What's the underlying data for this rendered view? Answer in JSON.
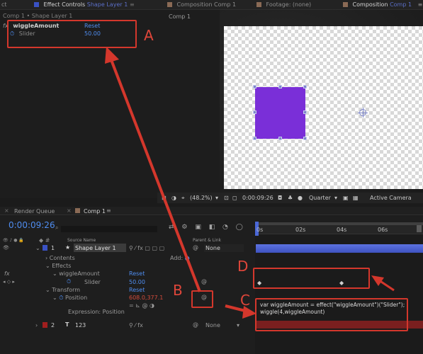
{
  "tabs": {
    "effect_controls": "Effect Controls",
    "effect_controls_layer": "Shape Layer 1",
    "composition_comp1": "Composition Comp 1",
    "footage": "Footage: (none)",
    "composition": "Composition",
    "composition_sub": "Comp 1"
  },
  "breadcrumb": "Comp 1 • Shape Layer 1",
  "viewer_tab": "Comp 1",
  "effect": {
    "name": "wiggleAmount",
    "reset": "Reset",
    "param": "Slider",
    "value": "50.00"
  },
  "viewer_bar": {
    "zoom": "(48.2%)",
    "timecode": "0:00:09:26",
    "resolution": "Quarter",
    "camera": "Active Camera"
  },
  "timeline": {
    "render_queue_tab": "Render Queue",
    "comp_tab": "Comp 1",
    "current_time": "0:00:09:26",
    "col_source_name": "Source Name",
    "col_parent": "Parent & Link",
    "ruler": [
      "0s",
      "02s",
      "04s",
      "06s"
    ],
    "layer1": {
      "num": "1",
      "name": "Shape Layer 1",
      "parent": "None"
    },
    "contents": "Contents",
    "add": "Add:",
    "effects": "Effects",
    "wiggle_amount": "wiggleAmount",
    "reset": "Reset",
    "slider": "Slider",
    "slider_value": "50.00",
    "transform": "Transform",
    "transform_reset": "Reset",
    "position": "Position",
    "position_value": "608.0,377.1",
    "expression_label": "Expression: Position",
    "expression_text_line1": "var wiggleAmount = effect(\"wiggleAmount\")(\"Slider\");",
    "expression_text_line2": "wiggle(4,wiggleAmount)",
    "layer2": {
      "num": "2",
      "name": "123",
      "parent": "None"
    }
  },
  "annotations": {
    "a": "A",
    "b": "B",
    "c": "C",
    "d": "D"
  },
  "colors": {
    "accent": "#4f8df0",
    "annotation": "#d4372c",
    "shape": "#7a2fd8"
  }
}
